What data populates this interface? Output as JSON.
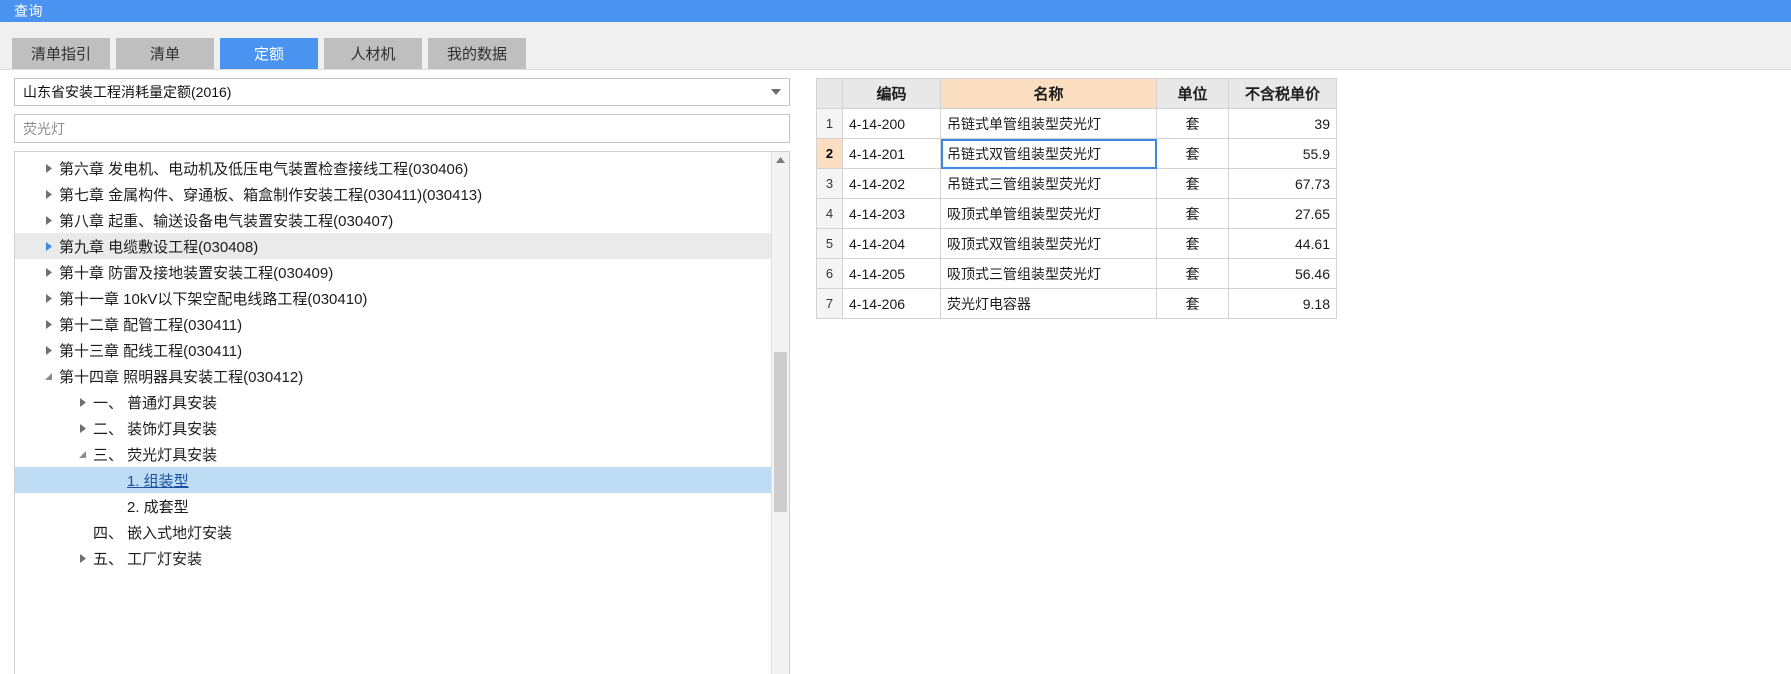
{
  "window": {
    "title": "查询"
  },
  "tabs": [
    {
      "label": "清单指引",
      "active": false
    },
    {
      "label": "清单",
      "active": false
    },
    {
      "label": "定额",
      "active": true
    },
    {
      "label": "人材机",
      "active": false
    },
    {
      "label": "我的数据",
      "active": false
    }
  ],
  "left": {
    "library_select": {
      "value": "山东省安装工程消耗量定额(2016)",
      "caret_icon": "chevron-down-icon"
    },
    "search": {
      "value": "荧光灯",
      "placeholder": "荧光灯"
    },
    "tree": [
      {
        "label": "第六章 发电机、电动机及低压电气装置检查接线工程(030406)",
        "level": 0,
        "arrow": "collapsed",
        "state": "normal"
      },
      {
        "label": "第七章 金属构件、穿通板、箱盒制作安装工程(030411)(030413)",
        "level": 0,
        "arrow": "collapsed",
        "state": "normal"
      },
      {
        "label": "第八章 起重、输送设备电气装置安装工程(030407)",
        "level": 0,
        "arrow": "collapsed",
        "state": "normal"
      },
      {
        "label": "第九章 电缆敷设工程(030408)",
        "level": 0,
        "arrow": "collapsed-blue",
        "state": "hover"
      },
      {
        "label": "第十章 防雷及接地装置安装工程(030409)",
        "level": 0,
        "arrow": "collapsed",
        "state": "normal"
      },
      {
        "label": "第十一章 10kV以下架空配电线路工程(030410)",
        "level": 0,
        "arrow": "collapsed",
        "state": "normal"
      },
      {
        "label": "第十二章 配管工程(030411)",
        "level": 0,
        "arrow": "collapsed",
        "state": "normal"
      },
      {
        "label": "第十三章 配线工程(030411)",
        "level": 0,
        "arrow": "collapsed",
        "state": "normal"
      },
      {
        "label": "第十四章 照明器具安装工程(030412)",
        "level": 0,
        "arrow": "expanded",
        "state": "normal"
      },
      {
        "label": "一、 普通灯具安装",
        "level": 1,
        "arrow": "collapsed",
        "state": "normal"
      },
      {
        "label": "二、 装饰灯具安装",
        "level": 1,
        "arrow": "collapsed",
        "state": "normal"
      },
      {
        "label": "三、 荧光灯具安装",
        "level": 1,
        "arrow": "expanded",
        "state": "normal"
      },
      {
        "label": "1. 组装型",
        "level": 2,
        "arrow": "none",
        "state": "selected"
      },
      {
        "label": "2. 成套型",
        "level": 2,
        "arrow": "none",
        "state": "normal"
      },
      {
        "label": "四、 嵌入式地灯安装",
        "level": 1,
        "arrow": "none",
        "state": "normal"
      },
      {
        "label": "五、 工厂灯安装",
        "level": 1,
        "arrow": "collapsed",
        "state": "normal"
      }
    ],
    "scrollbar": {
      "up_icon": "scroll-up-icon",
      "down_icon": "scroll-down-icon"
    }
  },
  "right": {
    "columns": [
      "",
      "编码",
      "名称",
      "单位",
      "不含税单价"
    ],
    "rows": [
      {
        "idx": "1",
        "code": "4-14-200",
        "name": "吊链式单管组装型荧光灯",
        "unit": "套",
        "price": "39",
        "selected": false
      },
      {
        "idx": "2",
        "code": "4-14-201",
        "name": "吊链式双管组装型荧光灯",
        "unit": "套",
        "price": "55.9",
        "selected": true
      },
      {
        "idx": "3",
        "code": "4-14-202",
        "name": "吊链式三管组装型荧光灯",
        "unit": "套",
        "price": "67.73",
        "selected": false
      },
      {
        "idx": "4",
        "code": "4-14-203",
        "name": "吸顶式单管组装型荧光灯",
        "unit": "套",
        "price": "27.65",
        "selected": false
      },
      {
        "idx": "5",
        "code": "4-14-204",
        "name": "吸顶式双管组装型荧光灯",
        "unit": "套",
        "price": "44.61",
        "selected": false
      },
      {
        "idx": "6",
        "code": "4-14-205",
        "name": "吸顶式三管组装型荧光灯",
        "unit": "套",
        "price": "56.46",
        "selected": false
      },
      {
        "idx": "7",
        "code": "4-14-206",
        "name": "荧光灯电容器",
        "unit": "套",
        "price": "9.18",
        "selected": false
      }
    ]
  },
  "colors": {
    "accent_blue": "#4a93f0",
    "header_orange": "#fbdfc0",
    "tree_selected": "#bfdcf5",
    "tab_inactive": "#bfbfbf"
  }
}
